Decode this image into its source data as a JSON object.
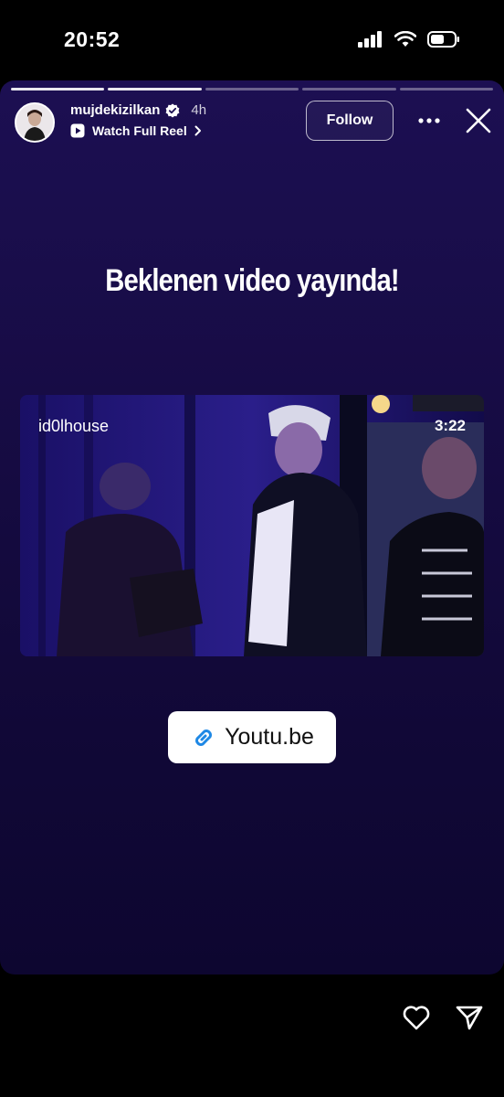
{
  "status": {
    "time": "20:52",
    "icons": [
      "signal-icon",
      "wifi-icon",
      "battery-icon"
    ]
  },
  "story": {
    "segments": 5,
    "current_segment": 2,
    "username": "mujdekizilkan",
    "verified": true,
    "time_ago": "4h",
    "reel_label": "Watch Full Reel",
    "follow_label": "Follow",
    "headline": "Beklenen video yayında!",
    "video": {
      "channel": "id0lhouse",
      "duration": "3:22"
    },
    "link_label": "Youtu.be"
  },
  "colors": {
    "story_bg": "#1c0f52",
    "link_icon": "#1e88e5",
    "verified_badge": "#ffffff"
  }
}
